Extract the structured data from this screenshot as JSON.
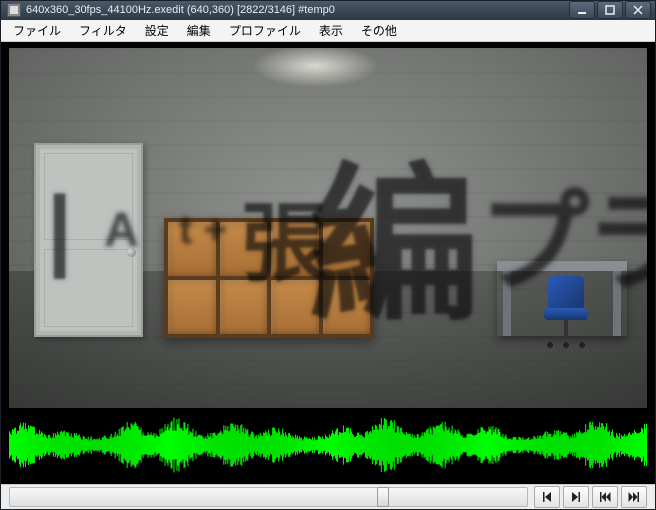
{
  "window": {
    "title": "640x360_30fps_44100Hz.exedit (640,360)  [2822/3146]  #temp0"
  },
  "menu": {
    "items": [
      {
        "label": "ファイル"
      },
      {
        "label": "フィルタ"
      },
      {
        "label": "設定"
      },
      {
        "label": "編集"
      },
      {
        "label": "プロファイル"
      },
      {
        "label": "表示"
      },
      {
        "label": "その他"
      }
    ]
  },
  "overlay_text": {
    "g0": "|",
    "g1": "A",
    "g2": "t +",
    "g3": "張",
    "g4": "編",
    "g5": "プラ"
  },
  "transport": {
    "seek_percent": 71,
    "buttons": {
      "step_back": "step-back-button",
      "step_forward": "step-forward-button",
      "go_first": "go-first-button",
      "go_last": "go-last-button"
    }
  }
}
